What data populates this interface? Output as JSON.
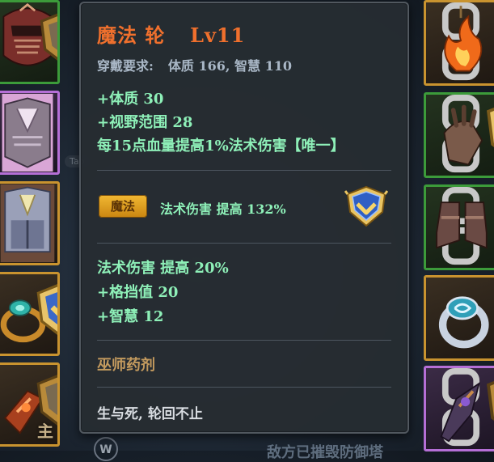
{
  "tooltip": {
    "title_name": "魔法 轮",
    "title_level": "Lv11",
    "requirement_label": "穿戴要求:",
    "requirement_values": "体质 166, 智慧 110",
    "base_stats": [
      "+体质 30",
      "+视野范围 28",
      "每15点血量提高1%法术伤害【唯一】"
    ],
    "gem": {
      "label": "魔法",
      "effect": "法术伤害 提高 132%"
    },
    "extra_stats": [
      "法术伤害 提高 20%",
      "+格挡值 20",
      "+智慧 12"
    ],
    "set_name": "巫师药剂",
    "flavor_text": "生与死, 轮回不止"
  },
  "hud": {
    "tab_hint": "Tab",
    "main_char": "主",
    "w_key": "W",
    "bottom_text": "敌方已摧毁防御塔"
  },
  "colors": {
    "title": "#f0702d",
    "stat_green": "#8ef0b8",
    "requirement": "#a9b7c6",
    "set_name": "#c39a5e",
    "gold_border": "#c9932f",
    "green_border": "#3c9b3a",
    "purple_border": "#b56fd6"
  },
  "icons": {
    "left_slots": [
      "helmet-icon",
      "chest-armor-icon",
      "chest-armor-icon",
      "ring-icon",
      "bracer-icon"
    ],
    "right_slots": [
      "flame-amulet-icon",
      "glove-icon",
      "boots-icon",
      "ring-icon",
      "dark-weapon-icon"
    ],
    "gem_icon": "rank-shield-icon"
  }
}
